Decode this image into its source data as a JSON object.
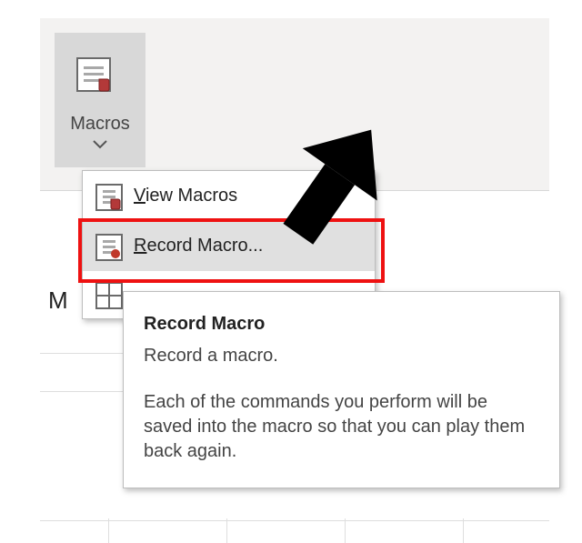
{
  "ribbon": {
    "macros_button_label": "Macros"
  },
  "menu": {
    "view_macros": "View Macros",
    "record_macro": "Record Macro...",
    "item3_partial": ""
  },
  "tooltip": {
    "title": "Record Macro",
    "subtitle": "Record a macro.",
    "body": "Each of the commands you perform will be saved into the macro so that you can play them back again."
  },
  "fragment": {
    "left_cell_text": "M"
  }
}
